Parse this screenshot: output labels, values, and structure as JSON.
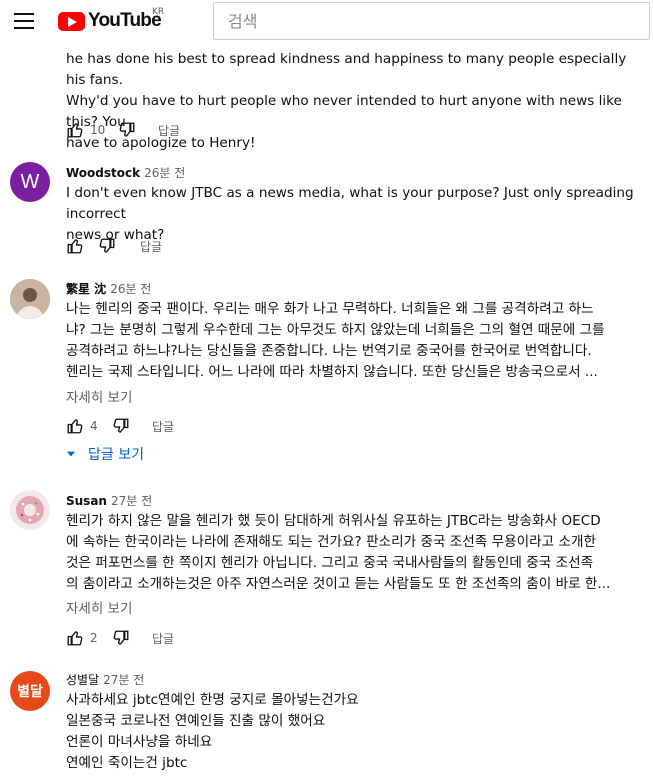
{
  "header": {
    "logo_text": "YouTube",
    "region": "KR",
    "search_placeholder": "검색"
  },
  "comments": [
    {
      "author": "",
      "time": "",
      "body": [
        "he has done his best to spread kindness and happiness to many people especially his fans.",
        "Why'd you have to hurt people who never intended to hurt anyone with news like this?  You",
        "have to apologize to Henry!"
      ],
      "likes": "10",
      "reply_label": "답글"
    },
    {
      "author": "Woodstock",
      "time": "26분 전",
      "avatar_letter": "W",
      "avatar_color": "#7b1fa2",
      "body": [
        "I don't even know JTBC as a news media, what is your purpose?  Just only spreading incorrect",
        "news or what?"
      ],
      "likes": "",
      "reply_label": "답글"
    },
    {
      "author": "繁星 沈",
      "time": "26분 전",
      "body": [
        "나는 헨리의 중국 팬이다. 우리는 매우 화가 나고 무력하다. 너희들은 왜 그를 공격하려고 하느",
        "냐? 그는 분명히 그렇게 우수한데 그는 아무것도 하지 않았는데 너희들은 그의 혈연 때문에 그를",
        "공격하려고 하느냐?나는 당신들을 존중합니다. 나는 번역기로 중국어를 한국어로 번역합니다.",
        "헨리는 국제 스타입니다. 어느 나라에 따라 차별하지 않습니다. 또한 당신들은 방송국으로서 ..."
      ],
      "read_more": "자세히 보기",
      "likes": "4",
      "reply_label": "답글",
      "view_replies": "답글 보기"
    },
    {
      "author": "Susan",
      "time": "27분 전",
      "body": [
        "헨리가 하지 않은 말을 헨리가 했 듯이 담대하게 허위사실 유포하는 JTBC라는 방송화사 OECD",
        "에 속하는 한국이라는 나라에 존재해도 되는 건가요? 판소리가 중국 조선족 무용이라고 소개한",
        "것은 퍼포먼스를 한 쪽이지 헨리가 아닙니다. 그리고 중국 국내사람들의 활동인데 중국 조선족",
        "의 춤이라고 소개하는것은 아주 자연스러운 것이고 듣는 사람들도 또 한 조선족의 춤이 바로 한..."
      ],
      "read_more": "자세히 보기",
      "likes": "2",
      "reply_label": "답글"
    },
    {
      "author": "성별달",
      "time": "27분 전",
      "avatar_letter": "별달",
      "avatar_color": "#e64a19",
      "body": [
        "사과하세요 jbtc연예인  한명 궁지로 몰아넣는건가요",
        "일본중국 코로나전 연예인들 진출 많이 했어요",
        "언론이 마녀사냥을 하네요",
        "연예인 죽이는건 jbtc"
      ]
    }
  ]
}
